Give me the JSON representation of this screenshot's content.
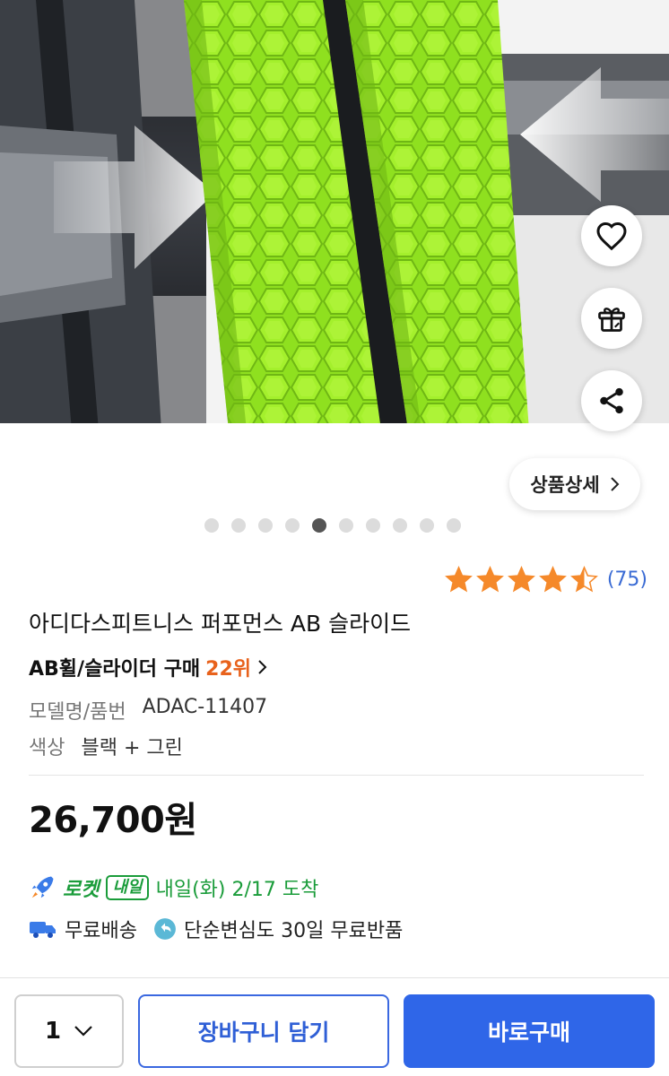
{
  "hero": {
    "image_name": "ab-slide-wheel-product-photo",
    "image_count": 10,
    "active_index": 4
  },
  "actions": {
    "wishlist_icon": "heart-icon",
    "gift_icon": "gift-icon",
    "share_icon": "share-icon"
  },
  "detail_button": {
    "label": "상품상세",
    "icon": "chevron-right-icon"
  },
  "rating": {
    "stars": 4.5,
    "count": "(75)",
    "star_color": "#f5892a"
  },
  "product": {
    "title": "아디다스피트니스 퍼포먼스 AB 슬라이드",
    "rank_label": "AB휠/슬라이더 구매",
    "rank_value": "22위",
    "model_label": "모델명/품번",
    "model_value": "ADAC-11407",
    "color_label": "색상",
    "color_value": "블랙 + 그린",
    "price": "26,700원"
  },
  "delivery": {
    "rocket_label": "로켓",
    "badge": "내일",
    "arrival": "내일(화) 2/17 도착",
    "accent_color": "#1a9c3a"
  },
  "perks": {
    "free_shipping": "무료배송",
    "free_return": "단순변심도 30일 무료반품"
  },
  "bottom_bar": {
    "quantity": "1",
    "cart_label": "장바구니 담기",
    "buy_label": "바로구매",
    "primary_color": "#2f66e8"
  }
}
